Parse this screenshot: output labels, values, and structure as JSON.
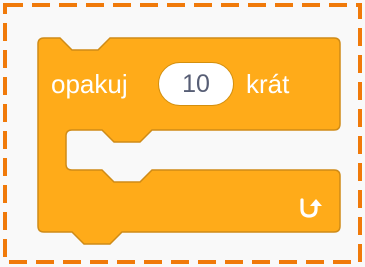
{
  "block": {
    "label_before": "opakuj",
    "count_value": "10",
    "label_after": "krát",
    "end_icon": "loop-arrow-icon"
  },
  "colors": {
    "block_fill": "#FFAB19",
    "block_stroke": "#CF8B17",
    "frame_dash": "#F07A0A",
    "input_text": "#575E75",
    "background": "#F9F9F9"
  }
}
